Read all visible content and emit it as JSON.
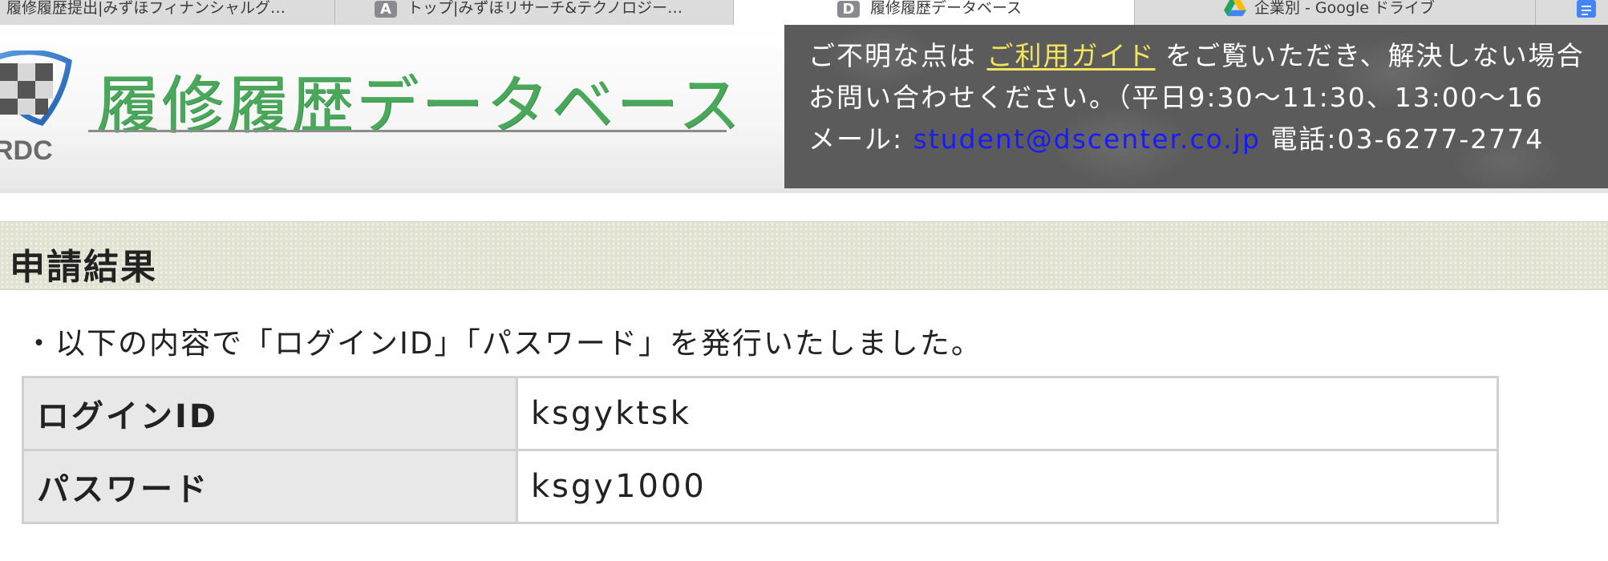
{
  "browser": {
    "tabs": [
      {
        "title": "履修履歴提出|みずほフィナンシャルグ…",
        "favicon": "",
        "active": false
      },
      {
        "title": "トップ|みずほリサーチ&テクノロジー…",
        "favicon": "A",
        "active": false
      },
      {
        "title": "履修履歴データベース",
        "favicon": "D",
        "active": true
      },
      {
        "title": "企業別 - Google ドライブ",
        "favicon": "google-drive-icon",
        "active": false
      }
    ],
    "extra_icon": "google-docs-icon"
  },
  "header": {
    "logo_text": "RDC",
    "site_title": "履修履歴データベース",
    "info": {
      "line1_prefix": "ご不明な点は ",
      "guide_link": "ご利用ガイド",
      "line1_suffix": " をご覧いただき、解決しない場合",
      "line2": "お問い合わせください。（平日9:30〜11:30、13:00〜16",
      "mail_label": "メール: ",
      "mail_address": "student@dscenter.co.jp",
      "phone": "  電話:03-6277-2774"
    }
  },
  "main": {
    "section_title": "申請結果",
    "notice": "・以下の内容で「ログインID」「パスワード」を発行いたしました。",
    "rows": [
      {
        "label": "ログインID",
        "value": "ksgyktsk"
      },
      {
        "label": "パスワード",
        "value": "ksgy1000"
      }
    ]
  },
  "colors": {
    "title_green": "#4aa85a",
    "guide_link": "#f3e45e",
    "mail_link": "#1a1aff",
    "info_panel_bg": "#5b5b5b",
    "section_bg": "#e2e2d2"
  }
}
